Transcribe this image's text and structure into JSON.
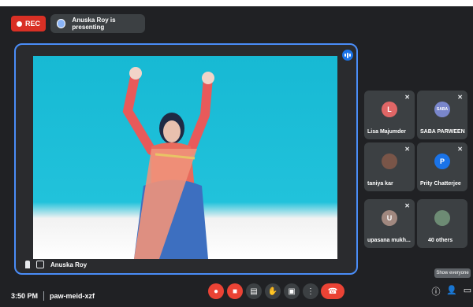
{
  "topbar": {
    "rec_label": "REC",
    "presenting_text": "Anuska Roy is presenting"
  },
  "main": {
    "presenter_name": "Anuska Roy"
  },
  "participants": [
    {
      "name": "Lisa Majumder",
      "initial": "L",
      "color": "#e06666"
    },
    {
      "name": "SABA PARWEEN",
      "initial": "SABA",
      "color": "#7986cb"
    },
    {
      "name": "taniya kar",
      "initial": "",
      "color": "#795548"
    },
    {
      "name": "Prity Chatterjee",
      "initial": "P",
      "color": "#1a73e8"
    },
    {
      "name": "upasana mukh...",
      "initial": "U",
      "color": "#a1887f"
    },
    {
      "name": "40 others",
      "initial": "",
      "color": "#6d8b74"
    }
  ],
  "bottombar": {
    "time": "3:50 PM",
    "meeting_code": "paw-meid-xzf",
    "tooltip": "Show everyone"
  },
  "colors": {
    "accent": "#4a8df8",
    "danger": "#ea4335",
    "background": "#202124"
  }
}
